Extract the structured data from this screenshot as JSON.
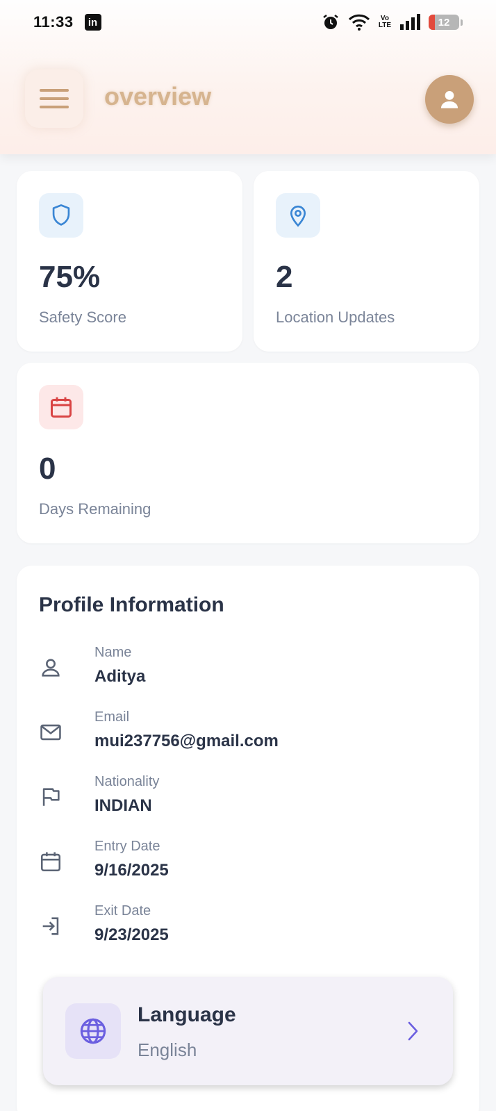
{
  "status_bar": {
    "time": "11:33",
    "linkedin_icon": "linkedin-icon",
    "volte": "Vo\nLTE",
    "battery": "12"
  },
  "header": {
    "title": "overview",
    "menu_icon": "menu-icon",
    "profile_icon": "user-icon",
    "accent_color": "#c9a079"
  },
  "stats": [
    {
      "icon": "shield-icon",
      "value": "75%",
      "label": "Safety Score",
      "color": "#3a86d4"
    },
    {
      "icon": "location-pin-icon",
      "value": "2",
      "label": "Location Updates",
      "color": "#3a86d4"
    },
    {
      "icon": "calendar-icon",
      "value": "0",
      "label": "Days Remaining",
      "color": "#d94444"
    }
  ],
  "profile": {
    "title": "Profile Information",
    "fields": [
      {
        "icon": "user-icon",
        "label": "Name",
        "value": "Aditya"
      },
      {
        "icon": "mail-icon",
        "label": "Email",
        "value": "mui237756@gmail.com"
      },
      {
        "icon": "flag-icon",
        "label": "Nationality",
        "value": "INDIAN"
      },
      {
        "icon": "calendar-icon",
        "label": "Entry Date",
        "value": "9/16/2025"
      },
      {
        "icon": "exit-icon",
        "label": "Exit Date",
        "value": "9/23/2025"
      }
    ]
  },
  "language": {
    "title": "Language",
    "value": "English",
    "icon": "globe-icon",
    "accent_color": "#6b5fe0"
  }
}
